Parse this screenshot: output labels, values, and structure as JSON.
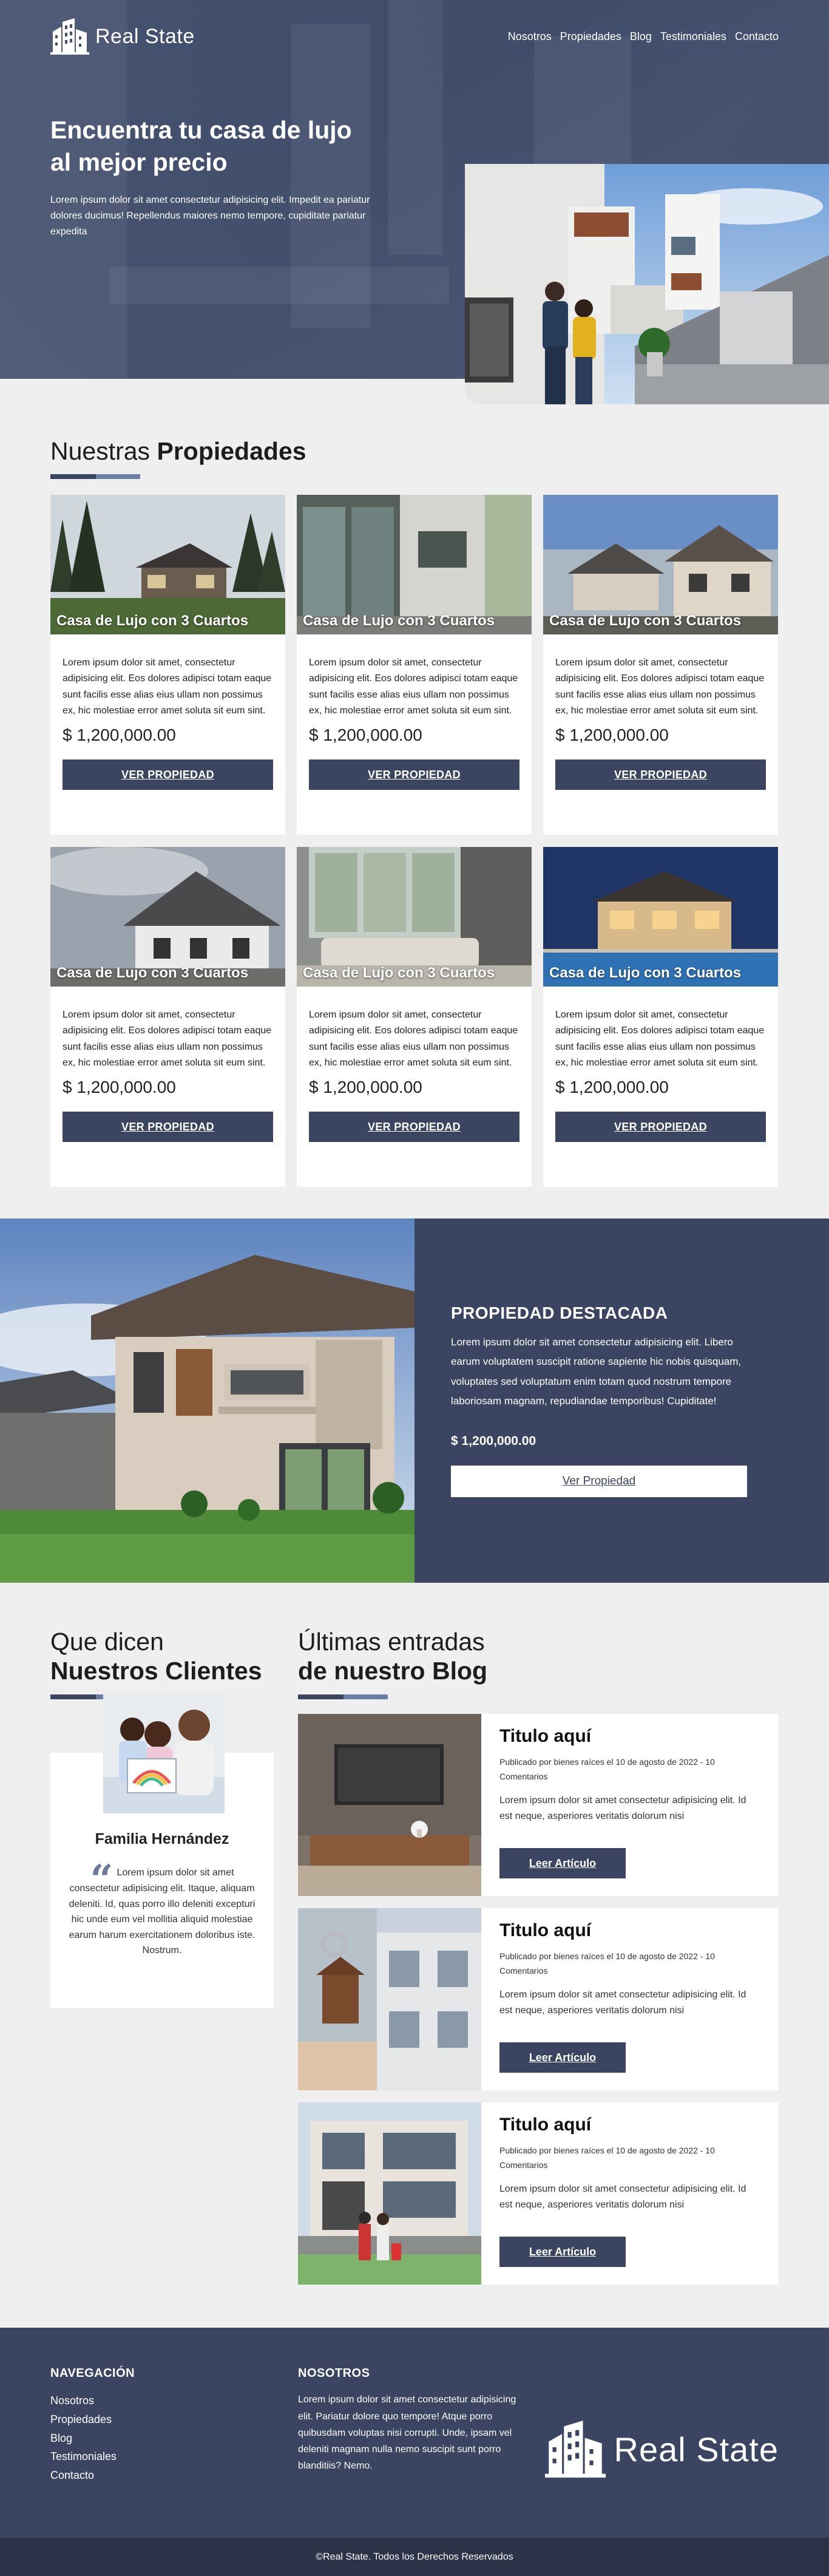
{
  "brand": {
    "name": "Real State"
  },
  "nav": {
    "items": [
      {
        "label": "Nosotros"
      },
      {
        "label": "Propiedades"
      },
      {
        "label": "Blog"
      },
      {
        "label": "Testimoniales"
      },
      {
        "label": "Contacto"
      }
    ]
  },
  "hero": {
    "title": "Encuentra tu casa de lujo al mejor precio",
    "text": "Lorem ipsum dolor sit amet consectetur adipisicing elit. Impedit ea pariatur dolores ducimus! Repellendus maiores nemo tempore, cupiditate pariatur expedita"
  },
  "properties": {
    "title_light": "Nuestras",
    "title_bold": "Propiedades",
    "items": [
      {
        "title": "Casa de Lujo con 3 Cuartos",
        "text": "Lorem ipsum dolor sit amet, consectetur adipisicing elit. Eos dolores adipisci totam eaque sunt facilis esse alias eius ullam non possimus ex, hic molestiae error amet soluta sit eum sint.",
        "price": "$ 1,200,000.00",
        "button": "VER PROPIEDAD"
      },
      {
        "title": "Casa de Lujo con 3 Cuartos",
        "text": "Lorem ipsum dolor sit amet, consectetur adipisicing elit. Eos dolores adipisci totam eaque sunt facilis esse alias eius ullam non possimus ex, hic molestiae error amet soluta sit eum sint.",
        "price": "$ 1,200,000.00",
        "button": "VER PROPIEDAD"
      },
      {
        "title": "Casa de Lujo con 3 Cuartos",
        "text": "Lorem ipsum dolor sit amet, consectetur adipisicing elit. Eos dolores adipisci totam eaque sunt facilis esse alias eius ullam non possimus ex, hic molestiae error amet soluta sit eum sint.",
        "price": "$ 1,200,000.00",
        "button": "VER PROPIEDAD"
      },
      {
        "title": "Casa de Lujo con 3 Cuartos",
        "text": "Lorem ipsum dolor sit amet, consectetur adipisicing elit. Eos dolores adipisci totam eaque sunt facilis esse alias eius ullam non possimus ex, hic molestiae error amet soluta sit eum sint.",
        "price": "$ 1,200,000.00",
        "button": "VER PROPIEDAD"
      },
      {
        "title": "Casa de Lujo con 3 Cuartos",
        "text": "Lorem ipsum dolor sit amet, consectetur adipisicing elit. Eos dolores adipisci totam eaque sunt facilis esse alias eius ullam non possimus ex, hic molestiae error amet soluta sit eum sint.",
        "price": "$ 1,200,000.00",
        "button": "VER PROPIEDAD"
      },
      {
        "title": "Casa de Lujo con 3 Cuartos",
        "text": "Lorem ipsum dolor sit amet, consectetur adipisicing elit. Eos dolores adipisci totam eaque sunt facilis esse alias eius ullam non possimus ex, hic molestiae error amet soluta sit eum sint.",
        "price": "$ 1,200,000.00",
        "button": "VER PROPIEDAD"
      }
    ]
  },
  "featured": {
    "heading": "PROPIEDAD DESTACADA",
    "text": "Lorem ipsum dolor sit amet consectetur adipisicing elit. Libero earum voluptatem suscipit ratione sapiente hic nobis quisquam, voluptates sed voluptatum enim totam quod nostrum tempore laboriosam magnam, repudiandae temporibus! Cupiditate!",
    "price": "$ 1,200,000.00",
    "button": "Ver Propiedad"
  },
  "testimonials": {
    "title_light": "Que dicen",
    "title_bold": "Nuestros Clientes",
    "name": "Familia Hernández",
    "quote": "Lorem ipsum dolor sit amet consectetur adipisicing elit. Itaque, aliquam deleniti. Id, quas porro illo deleniti excepturi hic unde eum vel mollitia aliquid molestiae earum harum exercitationem doloribus iste. Nostrum."
  },
  "blog": {
    "title_light": "Últimas entradas",
    "title_bold": "de nuestro Blog",
    "entries": [
      {
        "title": "Titulo aquí",
        "meta": "Publicado por bienes raíces el 10 de agosto de 2022 - 10 Comentarios",
        "text": "Lorem ipsum dolor sit amet consectetur adipisicing elit. Id est neque, asperiores veritatis dolorum nisi",
        "button": "Leer Artículo"
      },
      {
        "title": "Titulo aquí",
        "meta": "Publicado por bienes raíces el 10 de agosto de 2022 - 10 Comentarios",
        "text": "Lorem ipsum dolor sit amet consectetur adipisicing elit. Id est neque, asperiores veritatis dolorum nisi",
        "button": "Leer Artículo"
      },
      {
        "title": "Titulo aquí",
        "meta": "Publicado por bienes raíces el 10 de agosto de 2022 - 10 Comentarios",
        "text": "Lorem ipsum dolor sit amet consectetur adipisicing elit. Id est neque, asperiores veritatis dolorum nisi",
        "button": "Leer Artículo"
      }
    ]
  },
  "footer": {
    "nav_heading": "NAVEGACIÓN",
    "nav_items": [
      {
        "label": "Nosotros"
      },
      {
        "label": "Propiedades"
      },
      {
        "label": "Blog"
      },
      {
        "label": "Testimoniales"
      },
      {
        "label": "Contacto"
      }
    ],
    "about_heading": "NOSOTROS",
    "about_text": "Lorem ipsum dolor sit amet consectetur adipisicing elit. Pariatur dolore quo tempore! Atque porro quibusdam voluptas nisi corrupti. Unde, ipsam vel deleniti magnam nulla nemo suscipit sunt porro blanditiis? Nemo.",
    "brand": "Real State",
    "copyright": "©Real State. Todos los Derechos Reservados"
  },
  "icons": {
    "logo": "buildings-icon",
    "quote": "quote-icon"
  },
  "colors": {
    "primary": "#3b4561",
    "accent": "#6d7ea5",
    "background": "#efefef",
    "footer_bottom": "#2c3247"
  }
}
